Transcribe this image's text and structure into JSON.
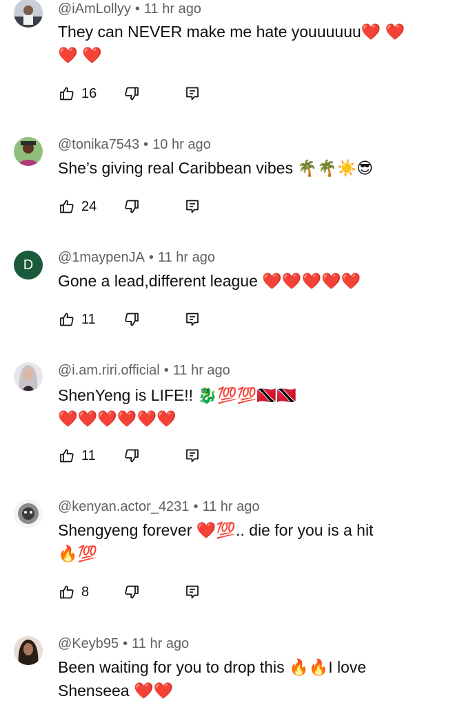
{
  "colors": {
    "muted": "#606060",
    "text": "#0f0f0f",
    "avatar_d": "#1c5a3c"
  },
  "icons": {
    "like": "thumbs-up-icon",
    "dislike": "thumbs-down-icon",
    "reply": "reply-icon"
  },
  "comments": [
    {
      "handle": "@iAmLollyy",
      "time": "11 hr ago",
      "lines": [
        "They can NEVER make me hate youuuuuu❤️ ❤️",
        "❤️ ❤️"
      ],
      "likes": "16",
      "avatar": "photo"
    },
    {
      "handle": "@tonika7543",
      "time": "10 hr ago",
      "lines": [
        "She’s giving real Caribbean vibes 🌴🌴☀️😎"
      ],
      "likes": "24",
      "avatar": "photo"
    },
    {
      "handle": "@1maypenJA",
      "time": "11 hr ago",
      "lines": [
        "Gone a lead,different league ❤️❤️❤️❤️❤️"
      ],
      "likes": "11",
      "avatar": "D"
    },
    {
      "handle": "@i.am.riri.official",
      "time": "11 hr ago",
      "lines": [
        "ShenYeng is LIFE!! 🐉💯💯🇹🇹🇹🇹",
        "❤️❤️❤️❤️❤️❤️"
      ],
      "likes": "11",
      "avatar": "photo"
    },
    {
      "handle": "@kenyan.actor_4231",
      "time": "11 hr ago",
      "lines": [
        "Shengyeng forever ❤️💯..  die for you is a hit",
        "🔥💯"
      ],
      "likes": "8",
      "avatar": "photo"
    },
    {
      "handle": "@Keyb95",
      "time": "11 hr ago",
      "lines": [
        "Been waiting for you to drop this 🔥🔥I love",
        "Shenseea ❤️❤️"
      ],
      "likes": "",
      "avatar": "photo"
    }
  ]
}
